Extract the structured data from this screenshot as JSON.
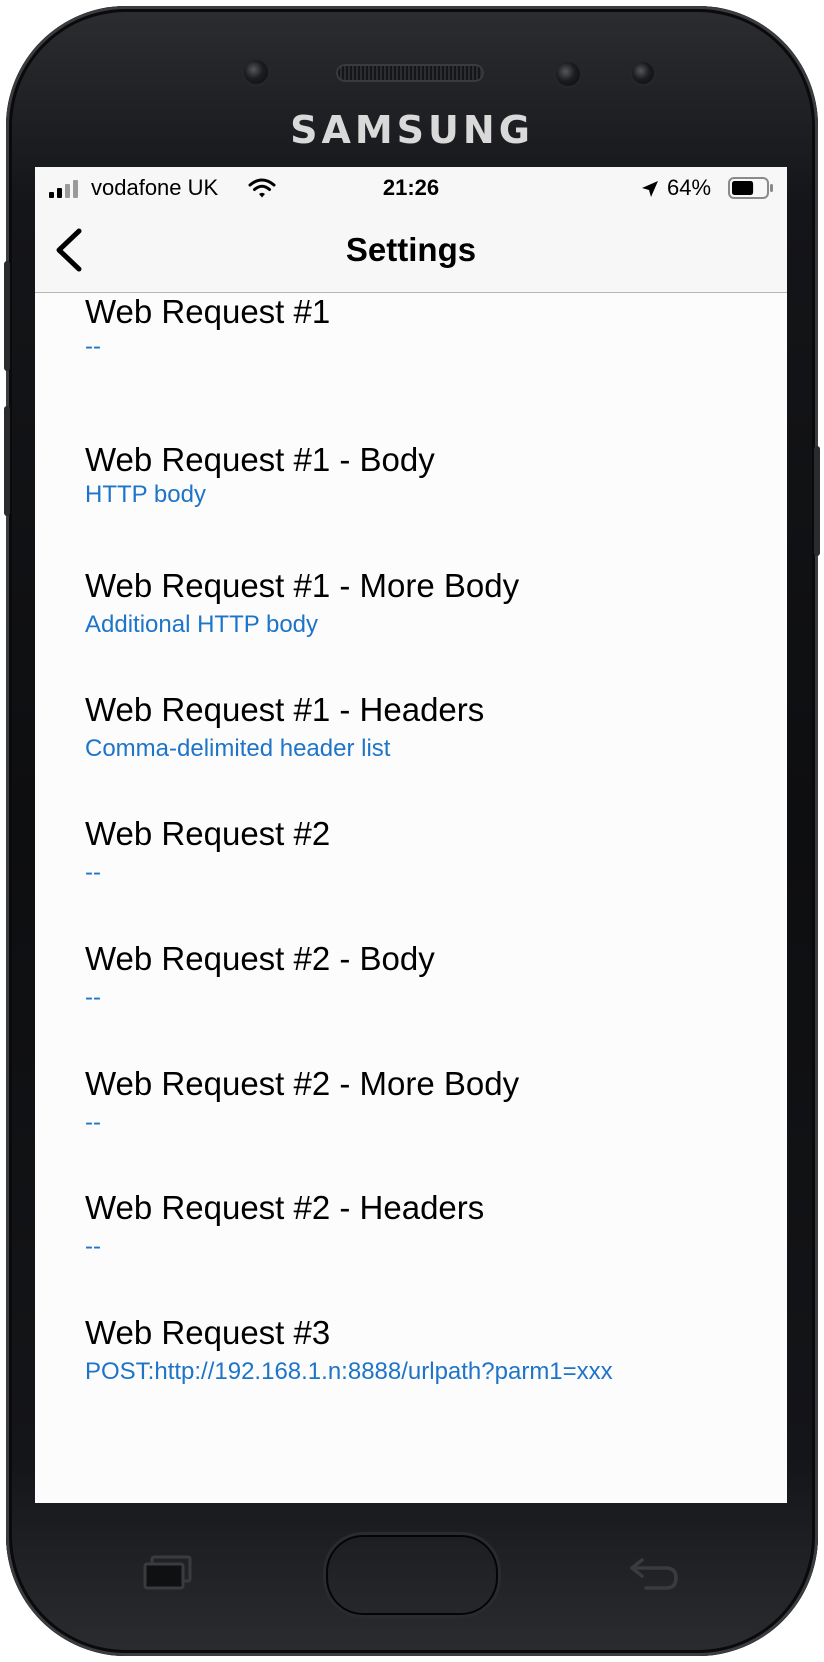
{
  "device": {
    "brand": "SAMSUNG"
  },
  "status_bar": {
    "carrier": "vodafone UK",
    "time": "21:26",
    "battery_percent": "64%",
    "battery_level": 0.64,
    "icons": [
      "signal-icon",
      "wifi-icon",
      "location-arrow-icon",
      "battery-icon"
    ]
  },
  "navbar": {
    "title": "Settings",
    "back_icon": "chevron-left-icon"
  },
  "settings": [
    {
      "label": "Web Request #1",
      "value": "--"
    },
    {
      "label": "Web Request #1 - Body",
      "value": "HTTP body"
    },
    {
      "label": "Web Request #1 - More Body",
      "value": "Additional HTTP body"
    },
    {
      "label": "Web Request #1 - Headers",
      "value": "Comma-delimited header list"
    },
    {
      "label": "Web Request #2",
      "value": "--"
    },
    {
      "label": "Web Request #2 - Body",
      "value": "--"
    },
    {
      "label": "Web Request #2 - More Body",
      "value": "--"
    },
    {
      "label": "Web Request #2 - Headers",
      "value": "--"
    },
    {
      "label": "Web Request #3",
      "value": "POST:http://192.168.1.n:8888/urlpath?parm1=xxx"
    }
  ],
  "colors": {
    "accent": "#1e74c8",
    "background": "#fcfcfc",
    "bar": "#f7f7f7"
  },
  "hardware_keys": [
    "recent-apps-icon",
    "home-button",
    "back-arrow-icon"
  ]
}
